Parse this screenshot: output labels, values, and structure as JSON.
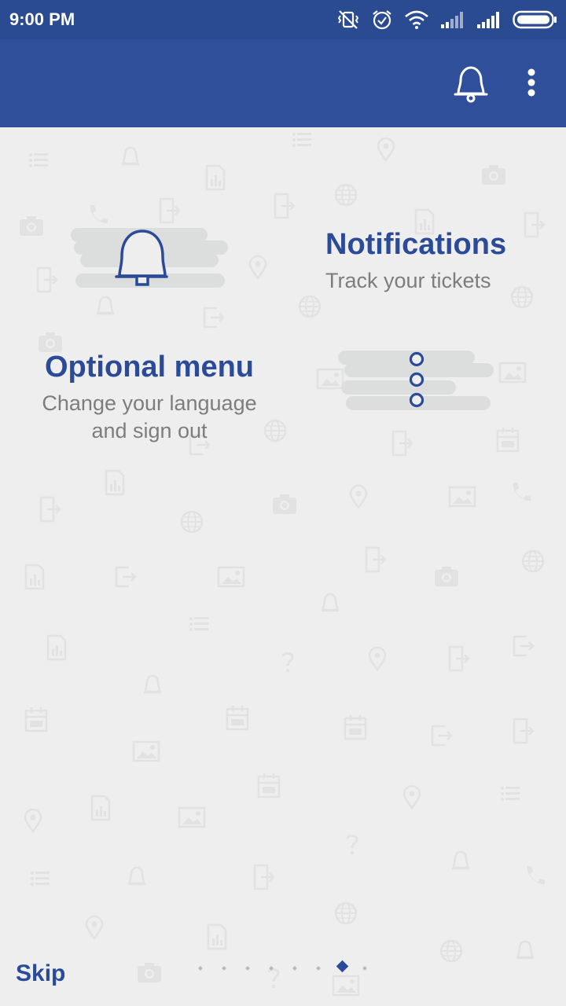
{
  "status_bar": {
    "time": "9:00 PM",
    "icons": [
      "vibrate-off-icon",
      "alarm-icon",
      "wifi-icon",
      "signal-icon",
      "signal-icon",
      "battery-icon"
    ]
  },
  "app_bar": {
    "actions": [
      "bell-icon",
      "more-vert-icon"
    ],
    "color": "#2f4f9b"
  },
  "tips": [
    {
      "title": "Notifications",
      "subtitle": "Track your tickets",
      "icon": "bell-icon"
    },
    {
      "title": "Optional menu",
      "subtitle_line1": "Change your language",
      "subtitle_line2": "and sign out",
      "icon": "more-vert-icon"
    }
  ],
  "footer": {
    "skip_label": "Skip",
    "pager": {
      "count": 8,
      "active_index": 6
    }
  },
  "colors": {
    "accent": "#2b4a97",
    "status_bar": "#2a4a92",
    "background": "#eeeeee",
    "subtitle": "#7d7d7d"
  }
}
